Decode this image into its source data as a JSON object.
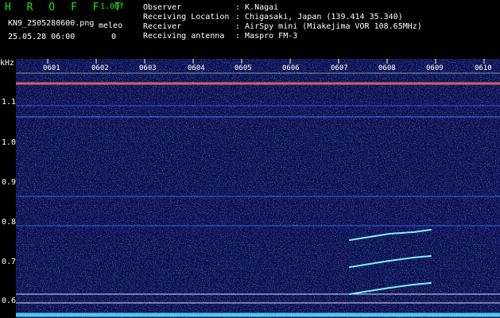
{
  "header": {
    "brand": "H R O F F T",
    "version": "1.00f",
    "filename": "KN9_2505280600.png",
    "meleo_label": "meleo",
    "timestamp": "25.05.28 06:00",
    "meleo_value": "0"
  },
  "info": [
    {
      "label": "Observer",
      "value": ": K.Nagai"
    },
    {
      "label": "Receiving Location",
      "value": ": Chigasaki, Japan (139.414 35.340)"
    },
    {
      "label": "Receiver",
      "value": ": AirSpy mini (Miakejima VOR 108.65MHz)"
    },
    {
      "label": "Receiving antenna",
      "value": ": Maspro FM-3"
    }
  ],
  "plot": {
    "y_unit": "kHz",
    "y_ticks": [
      "1.1",
      "1.0",
      "0.9",
      "0.8",
      "0.7",
      "0.6"
    ],
    "x_ticks": [
      "0601",
      "0602",
      "0603",
      "0604",
      "0605",
      "0606",
      "0607",
      "0608",
      "0609",
      "0610"
    ]
  },
  "colors": {
    "background": "#0a0f4d",
    "header_text": "#19e619",
    "trace": "#6fe0ff"
  }
}
